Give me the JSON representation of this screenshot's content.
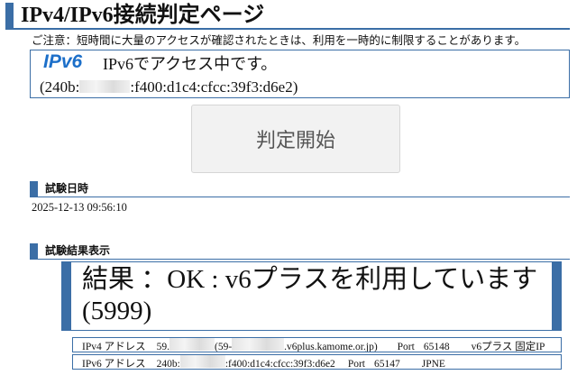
{
  "header": {
    "title": "IPv4/IPv6接続判定ページ"
  },
  "notice": "ご注意：短時間に大量のアクセスが確認されたときは、利用を一時的に制限することがあります。",
  "status": {
    "logo": "IPv6",
    "message": "IPv6でアクセス中です。",
    "address_prefix": "(240b:",
    "address_suffix": ":f400:d1c4:cfcc:39f3:d6e2)"
  },
  "start_button": {
    "label": "判定開始"
  },
  "test_date": {
    "heading": "試験日時",
    "value": "2025-12-13 09:56:10"
  },
  "results": {
    "heading": "試験結果表示",
    "summary": "結果 ：OK : v6プラスを利用しています(5999)",
    "ipv4": {
      "label": "IPv4 アドレス",
      "address_prefix": "59.",
      "host_prefix": "(59-",
      "host_suffix": ".v6plus.kamome.or.jp)",
      "port_label": "Port",
      "port": "65148",
      "service": "v6プラス 固定IP"
    },
    "ipv6": {
      "label": "IPv6 アドレス",
      "address_prefix": "240b:",
      "address_suffix": ":f400:d1c4:cfcc:39f3:d6e2",
      "port_label": "Port",
      "port": "65147",
      "provider": "JPNE"
    }
  },
  "colors": {
    "accent": "#3b6ea6",
    "logo": "#1c6fc9",
    "button_bg": "#f2f2f2"
  }
}
